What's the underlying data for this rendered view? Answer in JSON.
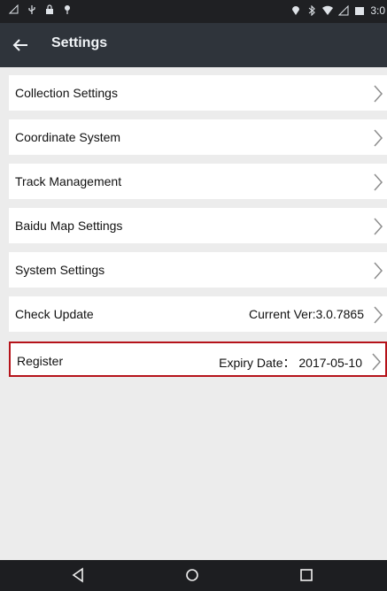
{
  "statusbar": {
    "icons_left": [
      "signal-off-icon",
      "usb-icon",
      "lock-icon",
      "pin-icon"
    ],
    "icons_right": [
      "location-icon",
      "bluetooth-icon",
      "wifi-icon",
      "signal-icon",
      "battery-icon"
    ],
    "time": "3:0"
  },
  "appbar": {
    "back_icon": "arrow-left-icon",
    "title": "Settings"
  },
  "settings": {
    "items": [
      {
        "label": "Collection Settings",
        "value": ""
      },
      {
        "label": "Coordinate System",
        "value": ""
      },
      {
        "label": "Track Management",
        "value": ""
      },
      {
        "label": "Baidu Map Settings",
        "value": ""
      },
      {
        "label": "System Settings",
        "value": ""
      },
      {
        "label": "Check Update",
        "value": "Current Ver:3.0.7865"
      },
      {
        "label": "Register",
        "value": "Expiry Date： 2017-05-10"
      }
    ]
  },
  "navbar": {
    "icons": [
      "back-triangle-icon",
      "home-circle-icon",
      "recents-square-icon"
    ]
  },
  "colors": {
    "appbar": "#2f343b",
    "statusbar": "#1f2023",
    "background": "#ececec",
    "highlight": "#b5131a"
  }
}
